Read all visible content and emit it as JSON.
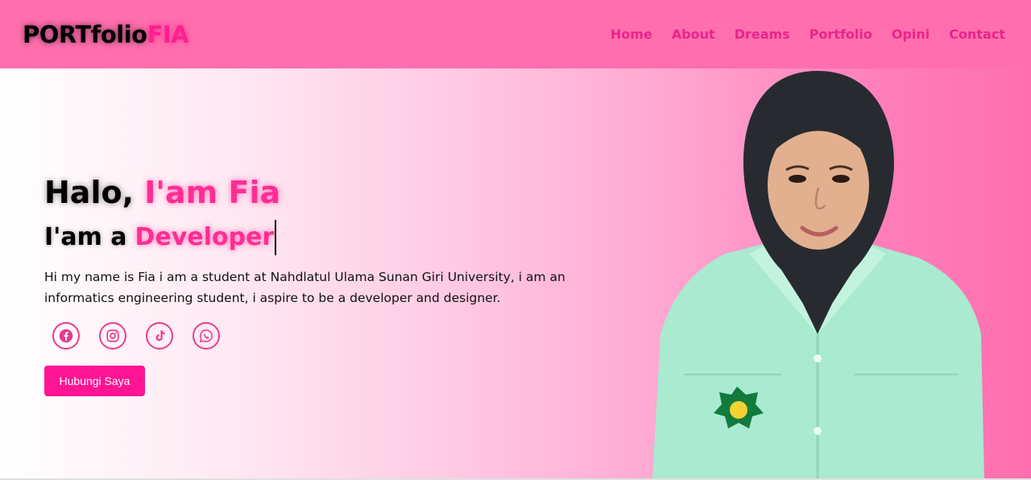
{
  "header": {
    "logo_main": "PORTfolio",
    "logo_accent": "FIA",
    "nav": [
      "Home",
      "About",
      "Dreams",
      "Portfolio",
      "Opini",
      "Contact"
    ]
  },
  "hero": {
    "greeting_prefix": "Halo,",
    "greeting_name": "I'am Fia",
    "role_prefix": "I'am a",
    "role_value": "Developer",
    "description": "Hi my name is Fia i am a student at Nahdlatul Ulama Sunan Giri University, i am an informatics engineering student, i aspire to be a developer and designer.",
    "socials": [
      "facebook-icon",
      "instagram-icon",
      "tiktok-icon",
      "whatsapp-icon"
    ],
    "cta_label": "Hubungi Saya"
  },
  "colors": {
    "nav_bg": "#ff6eae",
    "accent": "#ff2d93",
    "button": "#ff1493"
  }
}
